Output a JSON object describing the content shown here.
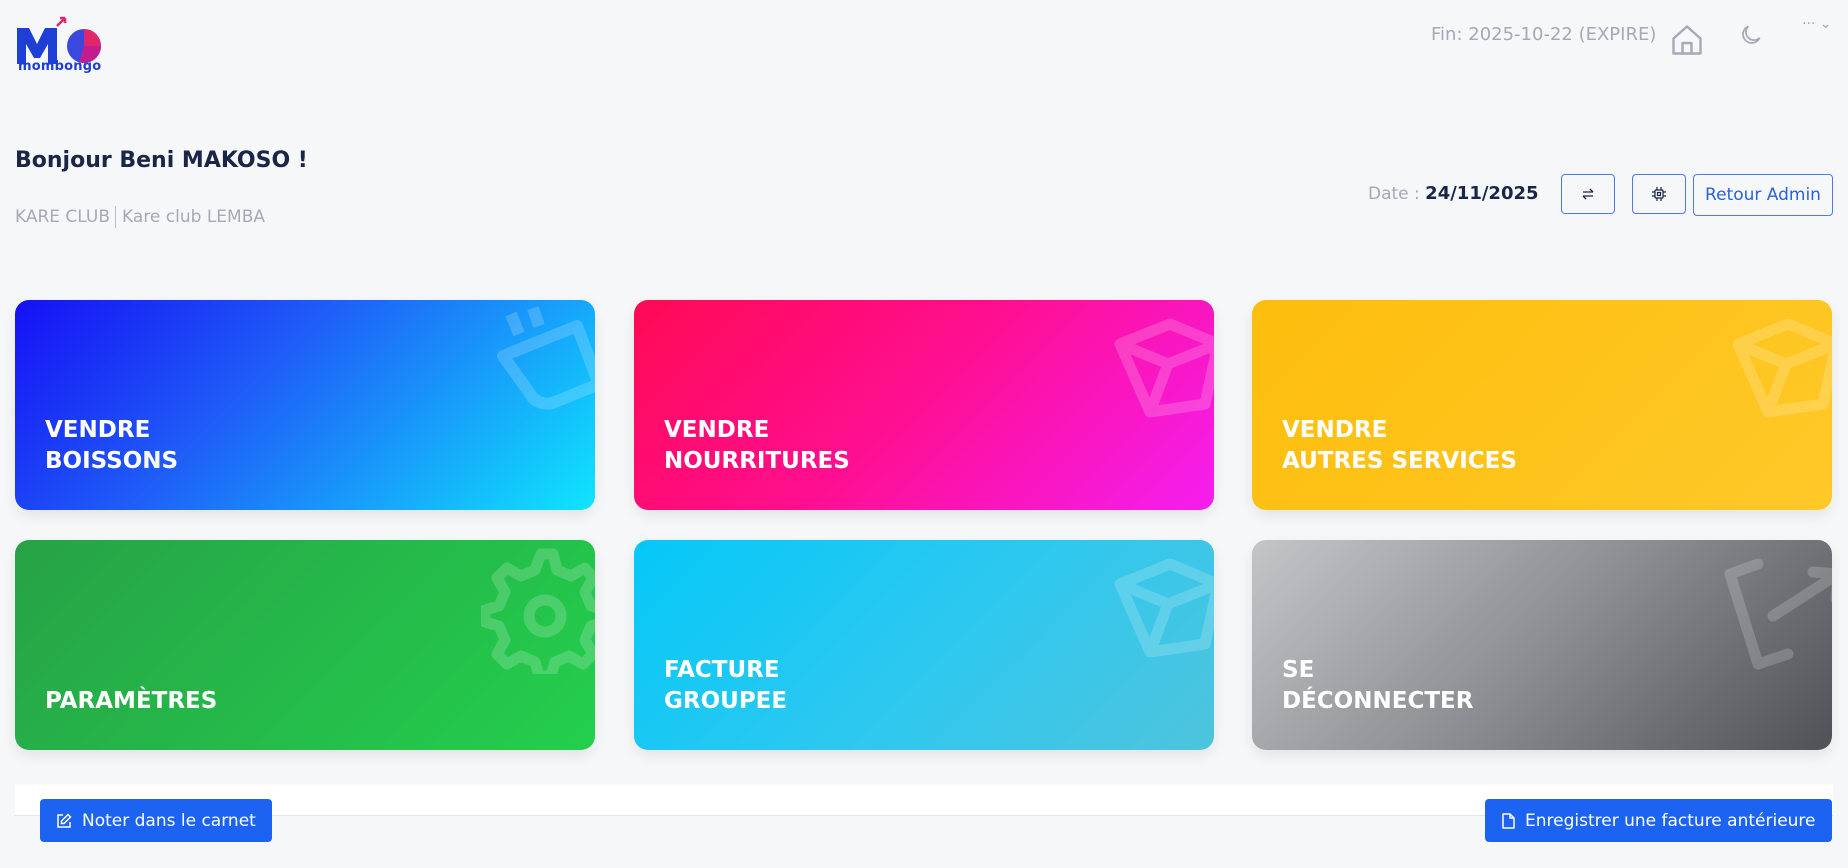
{
  "header": {
    "logo_text": "mombongo",
    "expiry": "Fin: 2025-10-22 (EXPIRE)",
    "user_menu": "··· ⌄"
  },
  "greeting": "Bonjour Beni MAKOSO !",
  "org": {
    "club": "KARE CLUB",
    "branch": "Kare club LEMBA"
  },
  "date": {
    "label": "Date :",
    "value": "24/11/2025"
  },
  "actions": {
    "back_admin": "Retour Admin"
  },
  "tiles": [
    {
      "line1": "VENDRE",
      "line2": "BOISSONS"
    },
    {
      "line1": "VENDRE",
      "line2": "NOURRITURES"
    },
    {
      "line1": "VENDRE",
      "line2": "AUTRES SERVICES"
    },
    {
      "line1": "",
      "line2": "PARAMÈTRES"
    },
    {
      "line1": "FACTURE",
      "line2": "GROUPEE"
    },
    {
      "line1": "SE",
      "line2": "DÉCONNECTER"
    }
  ],
  "footer": {
    "note_button": "Noter dans le carnet",
    "invoice_button": "Enregistrer une facture antérieure"
  },
  "colors": {
    "primary": "#1c63f2",
    "outline": "#4f7ae6"
  }
}
